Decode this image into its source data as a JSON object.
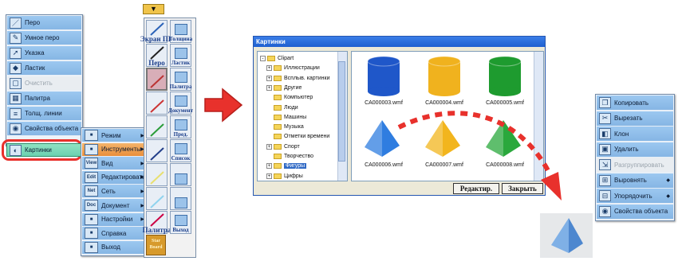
{
  "left_menu": {
    "items": [
      {
        "label": "Перо",
        "icon": "pen-icon"
      },
      {
        "label": "Умное перо",
        "icon": "smart-pen-icon"
      },
      {
        "label": "Указка",
        "icon": "pointer-icon"
      },
      {
        "label": "Ластик",
        "icon": "eraser-icon"
      },
      {
        "label": "Очистить",
        "icon": "clear-icon",
        "disabled": true
      },
      {
        "label": "Палитра",
        "icon": "palette-icon"
      },
      {
        "label": "Толщ. линии",
        "icon": "line-width-icon"
      },
      {
        "label": "Свойства объекта",
        "icon": "object-properties-icon"
      }
    ],
    "highlighted_item": "Картинки"
  },
  "submenu": {
    "items": [
      {
        "label": "Режим",
        "icon_text": "",
        "arrow": true
      },
      {
        "label": "Инструменты",
        "icon_text": "",
        "arrow": true,
        "selected": true
      },
      {
        "label": "Вид",
        "icon_text": "View",
        "arrow": true
      },
      {
        "label": "Редактировать",
        "icon_text": "Edit",
        "arrow": true
      },
      {
        "label": "Сеть",
        "icon_text": "Net",
        "arrow": true
      },
      {
        "label": "Документ",
        "icon_text": "Doc",
        "arrow": true
      },
      {
        "label": "Настройки",
        "icon_text": "",
        "arrow": true
      },
      {
        "label": "Справка",
        "icon_text": "",
        "arrow": false
      },
      {
        "label": "Выход",
        "icon_text": "",
        "arrow": false
      }
    ]
  },
  "toolbar": {
    "buttons": [
      {
        "label": "Экран ПК",
        "label2": "Толщина"
      },
      {
        "label": "Перо",
        "label2": "Ластик"
      },
      {
        "label": "",
        "label2": "Палитра"
      },
      {
        "label": "",
        "label2": "Документ"
      },
      {
        "label": "",
        "label2": "Пред."
      },
      {
        "label": "",
        "label2": "Список"
      },
      {
        "label": "",
        "label2": ""
      },
      {
        "label": "",
        "label2": ""
      },
      {
        "label": "Палитра",
        "label2": "Выход"
      }
    ],
    "logo_text": "Star Board"
  },
  "clipart_window": {
    "title": "Картинки",
    "tree": [
      {
        "label": "Clipart",
        "level": 0,
        "expand": "-"
      },
      {
        "label": "Иллюстрации",
        "level": 1,
        "expand": "+"
      },
      {
        "label": "Всплыв. картинки",
        "level": 1,
        "expand": "+"
      },
      {
        "label": "Другие",
        "level": 1,
        "expand": "+"
      },
      {
        "label": "Компьютер",
        "level": 1,
        "expand": ""
      },
      {
        "label": "Люди",
        "level": 1,
        "expand": ""
      },
      {
        "label": "Машины",
        "level": 1,
        "expand": ""
      },
      {
        "label": "Музыка",
        "level": 1,
        "expand": ""
      },
      {
        "label": "Отметки времени",
        "level": 1,
        "expand": ""
      },
      {
        "label": "Спорт",
        "level": 1,
        "expand": "+"
      },
      {
        "label": "Творчество",
        "level": 1,
        "expand": ""
      },
      {
        "label": "Фигуры",
        "level": 1,
        "expand": "+",
        "selected": true
      },
      {
        "label": "Цифры",
        "level": 1,
        "expand": "+"
      }
    ],
    "thumbnails": [
      {
        "caption": "CA000003.wmf",
        "shape": "cylinder",
        "color": "#1f57c9"
      },
      {
        "caption": "CA000004.wmf",
        "shape": "cylinder",
        "color": "#f0b21e"
      },
      {
        "caption": "CA000005.wmf",
        "shape": "cylinder",
        "color": "#1e9b2f"
      },
      {
        "caption": "CA000006.wmf",
        "shape": "pyramid",
        "color": "#2f7de0"
      },
      {
        "caption": "CA000007.wmf",
        "shape": "pyramid",
        "color": "#f2b51d"
      },
      {
        "caption": "CA000008.wmf",
        "shape": "pyramid",
        "color": "#2aa83c"
      }
    ],
    "edit_button": "Редактир.",
    "close_button": "Закрыть"
  },
  "context_menu": {
    "items": [
      {
        "label": "Копировать",
        "arrow": false,
        "disabled": false
      },
      {
        "label": "Вырезать",
        "arrow": false,
        "disabled": false
      },
      {
        "label": "Клон",
        "arrow": false,
        "disabled": false
      },
      {
        "label": "Удалить",
        "arrow": false,
        "disabled": false
      },
      {
        "label": "Разгруппировать",
        "arrow": false,
        "disabled": true
      },
      {
        "label": "Выровнять",
        "arrow": true,
        "disabled": false
      },
      {
        "label": "Упорядочить",
        "arrow": true,
        "disabled": false
      },
      {
        "label": "Свойства объекта",
        "arrow": false,
        "disabled": false
      }
    ]
  },
  "colors": {
    "accent_red": "#e8312c",
    "menu_blue": "#8fbfe9",
    "highlight_green": "#6fd3b2",
    "selected_orange": "#ee9a45"
  }
}
